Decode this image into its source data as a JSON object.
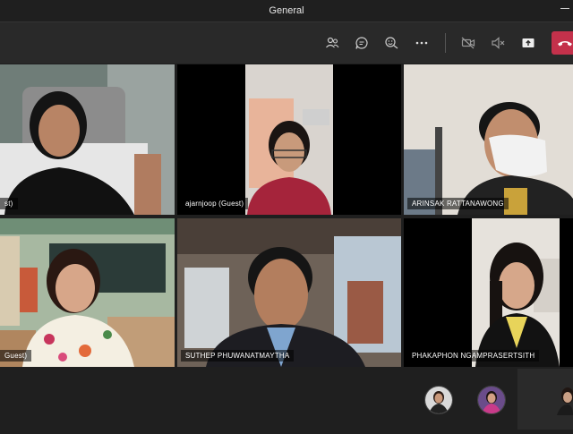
{
  "window": {
    "title": "General"
  },
  "toolbar": {
    "icons": [
      "participants-icon",
      "chat-icon",
      "reactions-icon",
      "more-icon",
      "camera-off-icon",
      "mic-muted-icon",
      "share-screen-icon",
      "hang-up-icon"
    ]
  },
  "participants": [
    {
      "name": "st)"
    },
    {
      "name": "ajarnjoop (Guest)"
    },
    {
      "name": "ARINSAK RATTANAWONG"
    },
    {
      "name": "Guest)"
    },
    {
      "name": "SUTHEP PHUWANATMAYTHA"
    },
    {
      "name": "PHAKAPHON NGAMPRASERTSITH"
    }
  ],
  "colors": {
    "hangup": "#c4314b",
    "toolbar": "#292929",
    "background": "#1f1f1f"
  }
}
